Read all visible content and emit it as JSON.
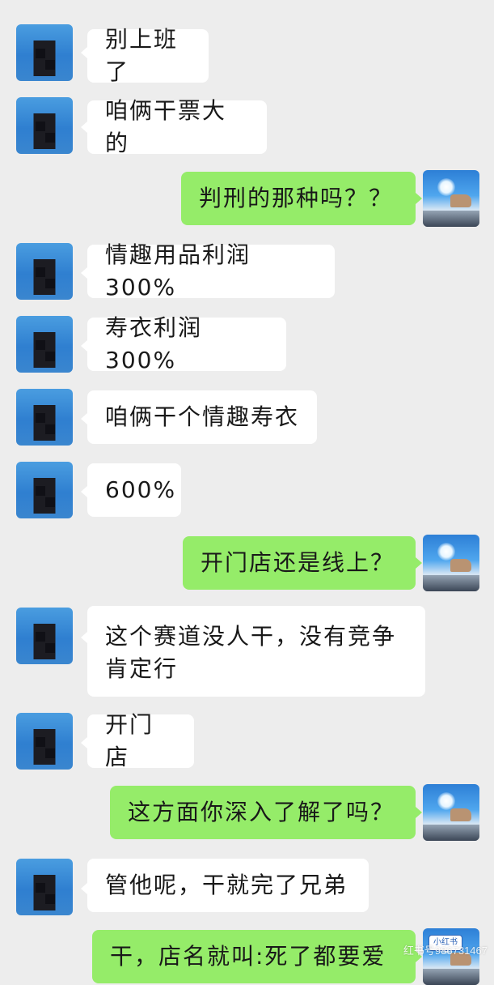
{
  "messages": [
    {
      "side": "in",
      "text": "别上班了"
    },
    {
      "side": "in",
      "text": "咱俩干票大的"
    },
    {
      "side": "out",
      "text": "判刑的那种吗？？"
    },
    {
      "side": "in",
      "text": "情趣用品利润300%"
    },
    {
      "side": "in",
      "text": "寿衣利润300%"
    },
    {
      "side": "in",
      "text": "咱俩干个情趣寿衣"
    },
    {
      "side": "in",
      "text": "600%"
    },
    {
      "side": "out",
      "text": "开门店还是线上？"
    },
    {
      "side": "in",
      "text": "这个赛道没人干，没有竞争",
      "text2": "肯定行"
    },
    {
      "side": "in",
      "text": "开门店"
    },
    {
      "side": "out",
      "text": "这方面你深入了解了吗？"
    },
    {
      "side": "in",
      "text": "管他呢，干就完了兄弟"
    },
    {
      "side": "out",
      "text": "干，店名就叫:死了都要爱"
    }
  ],
  "watermark": {
    "logo": "小红书",
    "text": "红书号986731467"
  },
  "colors": {
    "background": "#ededed",
    "incoming": "#ffffff",
    "outgoing": "#95ec69"
  },
  "icons": {
    "incoming_avatar": "avatar-blurred-person",
    "outgoing_avatar": "avatar-sky-thumbs-up"
  }
}
